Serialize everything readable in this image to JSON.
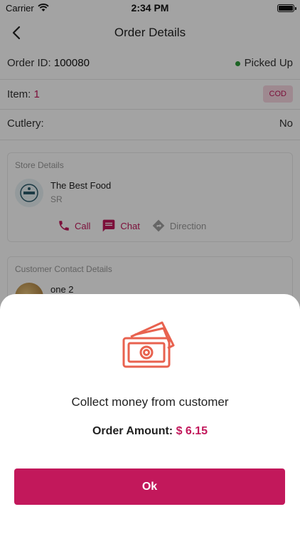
{
  "status_bar": {
    "carrier": "Carrier",
    "time": "2:34 PM",
    "icons": [
      "wifi-icon",
      "battery-icon"
    ]
  },
  "nav": {
    "title": "Order Details",
    "back_icon": "chevron-left-icon"
  },
  "order": {
    "id_label": "Order ID:",
    "id_value": "100080",
    "status": "Picked Up",
    "status_color": "#2e9d3a",
    "item_label": "Item:",
    "item_value": "1",
    "payment_badge": "COD",
    "cutlery_label": "Cutlery:",
    "cutlery_value": "No"
  },
  "store_card": {
    "title": "Store Details",
    "name": "The Best Food",
    "subtitle": "SR",
    "actions": [
      {
        "label": "Call",
        "icon": "phone-icon"
      },
      {
        "label": "Chat",
        "icon": "chat-icon"
      },
      {
        "label": "Direction",
        "icon": "direction-icon"
      }
    ]
  },
  "customer_card": {
    "title": "Customer Contact Details",
    "name": "one 2"
  },
  "sheet": {
    "icon": "cash-icon",
    "message": "Collect money from customer",
    "amount_label": "Order Amount:",
    "amount_value": "$ 6.15",
    "ok_label": "Ok"
  },
  "colors": {
    "accent": "#c2185b",
    "icon_stroke": "#e8624f",
    "badge_bg": "#f8d7e1"
  }
}
